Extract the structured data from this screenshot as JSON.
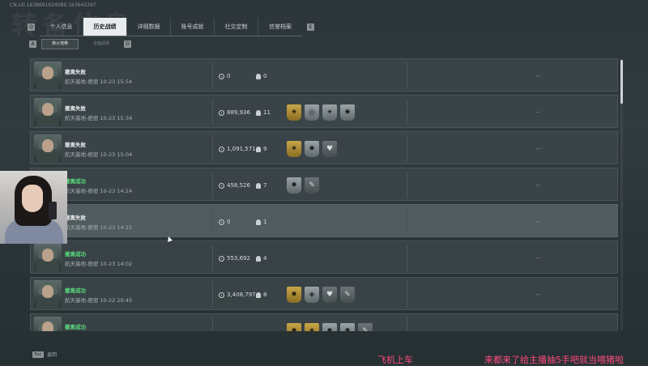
{
  "header": {
    "uid": "CN.U0.1838691924080.163645297",
    "bg_title": "转备信息"
  },
  "tabs": {
    "left_key": "Q",
    "right_key": "E",
    "items": [
      "个人信息",
      "历史战绩",
      "详细数据",
      "账号成就",
      "社交定制",
      "信誉档案"
    ],
    "active": "历史战绩"
  },
  "filters": {
    "left_key": "A",
    "right_key": "D",
    "items": [
      {
        "label": "烽火地带"
      },
      {
        "label": "全面战场"
      }
    ]
  },
  "matches": [
    {
      "status": "撤离失败",
      "success": false,
      "location": "航天基地-绝密 10-23 15:54",
      "money": "0",
      "kills": "0",
      "badges": [],
      "extra": "--"
    },
    {
      "status": "撤离失败",
      "success": false,
      "location": "航天基地-绝密 10-23 15:34",
      "money": "889,936",
      "kills": "11",
      "badges": [
        {
          "style": "gold",
          "icon": "✷"
        },
        {
          "style": "silver",
          "icon": "◎"
        },
        {
          "style": "silver",
          "icon": "✦"
        },
        {
          "style": "silver",
          "icon": "✸"
        }
      ],
      "extra": "--"
    },
    {
      "status": "撤离失败",
      "success": false,
      "location": "航天基地-绝密 10-23 15:04",
      "money": "1,091,571",
      "kills": "9",
      "badges": [
        {
          "style": "gold",
          "icon": "✷"
        },
        {
          "style": "silver",
          "icon": "✸"
        },
        {
          "style": "dark",
          "icon": "♥"
        }
      ],
      "extra": "--"
    },
    {
      "status": "撤离成功",
      "success": true,
      "location": "航天基地-绝密 10-23 14:24",
      "money": "458,526",
      "kills": "7",
      "badges": [
        {
          "style": "silver",
          "icon": "✸"
        },
        {
          "style": "dark",
          "icon": "✎"
        }
      ],
      "extra": "--"
    },
    {
      "status": "撤离失败",
      "success": false,
      "location": "航天基地-绝密 10-23 14:15",
      "money": "0",
      "kills": "1",
      "badges": [],
      "extra": "--"
    },
    {
      "status": "撤离成功",
      "success": true,
      "location": "航天基地-绝密 10-23 14:02",
      "money": "553,692",
      "kills": "4",
      "badges": [],
      "extra": "--"
    },
    {
      "status": "撤离成功",
      "success": true,
      "location": "航天基地-绝密 10-22 20:45",
      "money": "3,408,797",
      "kills": "8",
      "badges": [
        {
          "style": "gold",
          "icon": "✹"
        },
        {
          "style": "silver",
          "icon": "◈"
        },
        {
          "style": "dark",
          "icon": "♥"
        },
        {
          "style": "dark",
          "icon": "✎"
        }
      ],
      "extra": "--"
    },
    {
      "status": "撤离成功",
      "success": true,
      "location": "",
      "money": "",
      "kills": "",
      "badges": [
        {
          "style": "gold",
          "icon": "✹"
        },
        {
          "style": "gold",
          "icon": "✷"
        },
        {
          "style": "silver",
          "icon": "✸"
        },
        {
          "style": "silver",
          "icon": "✸"
        },
        {
          "style": "dark",
          "icon": "✎"
        }
      ],
      "extra": ""
    }
  ],
  "footer": {
    "esc_key": "Esc",
    "back_label": "返回"
  },
  "overlay": {
    "danmu": [
      "飞机上车",
      "来都来了给主播抽5手吧就当喂猪啦"
    ]
  },
  "colors": {
    "success": "#59d97c",
    "danmu": "#ff4a7d",
    "active_tab_bg": "#e9ecec"
  }
}
